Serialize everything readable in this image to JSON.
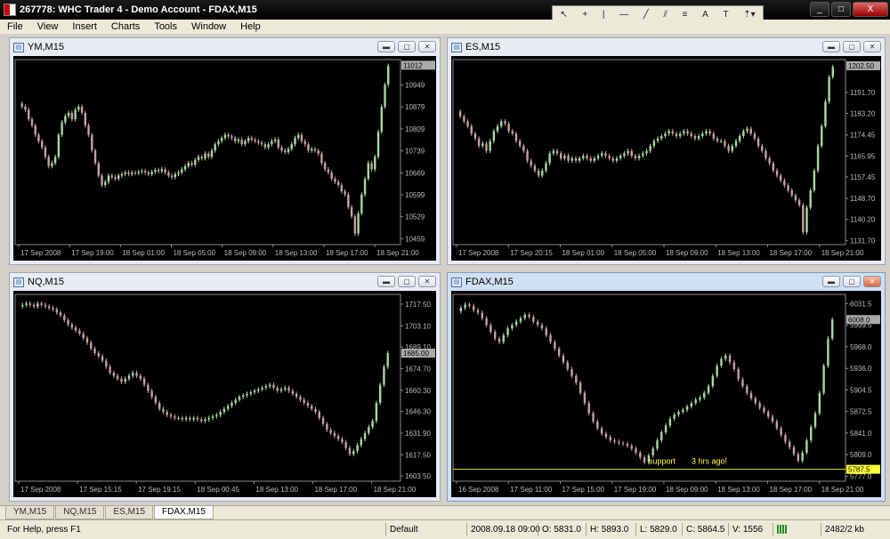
{
  "window": {
    "title": "267778: WHC Trader 4 - Demo Account - FDAX,M15",
    "minimize": "_",
    "maximize": "□",
    "close": "X"
  },
  "toolbox": {
    "icons": [
      "cursor-icon",
      "crosshair-icon",
      "vertical-line-icon",
      "horizontal-line-icon",
      "trendline-icon",
      "channel-icon",
      "fibonacci-icon",
      "text-icon",
      "label-icon",
      "arrow-icon"
    ]
  },
  "menu": [
    {
      "label": "File"
    },
    {
      "label": "View"
    },
    {
      "label": "Insert"
    },
    {
      "label": "Charts"
    },
    {
      "label": "Tools"
    },
    {
      "label": "Window"
    },
    {
      "label": "Help"
    }
  ],
  "charts": [
    {
      "id": "ym",
      "title": "YM,M15",
      "active": false,
      "price_labels": [
        "10949",
        "10879",
        "10809",
        "10739",
        "10669",
        "10599",
        "10529",
        "10459"
      ],
      "current_price": "11012",
      "time_labels": [
        "17 Sep 2008",
        "17 Sep 19:00",
        "18 Sep 01:00",
        "18 Sep 05:00",
        "18 Sep 09:00",
        "18 Sep 13:00",
        "18 Sep 17:00",
        "18 Sep 21:00"
      ],
      "ylim": [
        10440,
        11030
      ],
      "series": [
        10890,
        10880,
        10870,
        10840,
        10820,
        10790,
        10770,
        10750,
        10720,
        10690,
        10700,
        10720,
        10790,
        10830,
        10850,
        10860,
        10840,
        10870,
        10880,
        10860,
        10820,
        10790,
        10740,
        10700,
        10660,
        10630,
        10640,
        10660,
        10655,
        10650,
        10660,
        10665,
        10670,
        10665,
        10670,
        10668,
        10672,
        10675,
        10670,
        10665,
        10672,
        10678,
        10674,
        10680,
        10670,
        10660,
        10655,
        10665,
        10670,
        10680,
        10690,
        10700,
        10695,
        10710,
        10720,
        10715,
        10730,
        10720,
        10740,
        10760,
        10770,
        10780,
        10790,
        10785,
        10780,
        10770,
        10775,
        10760,
        10770,
        10780,
        10775,
        10770,
        10765,
        10760,
        10750,
        10760,
        10770,
        10775,
        10750,
        10740,
        10735,
        10745,
        10760,
        10780,
        10790,
        10770,
        10760,
        10740,
        10745,
        10740,
        10730,
        10700,
        10680,
        10670,
        10650,
        10640,
        10630,
        10610,
        10600,
        10560,
        10530,
        10475,
        10540,
        10600,
        10650,
        10700,
        10680,
        10720,
        10800,
        10880,
        10950,
        11010
      ]
    },
    {
      "id": "es",
      "title": "ES,M15",
      "active": false,
      "price_labels": [
        "1191.70",
        "1183.20",
        "1174.45",
        "1165.95",
        "1157.45",
        "1148.70",
        "1140.20",
        "1131.70"
      ],
      "current_price": "1202.50",
      "time_labels": [
        "17 Sep 2008",
        "17 Sep 20:15",
        "18 Sep 01:00",
        "18 Sep 05:00",
        "18 Sep 09:00",
        "18 Sep 13:00",
        "18 Sep 17:00",
        "18 Sep 21:00"
      ],
      "ylim": [
        1130,
        1205
      ],
      "series": [
        1184,
        1182,
        1180,
        1178,
        1175,
        1173,
        1170,
        1171,
        1168,
        1172,
        1176,
        1178,
        1180,
        1179,
        1176,
        1175,
        1172,
        1170,
        1168,
        1164,
        1162,
        1160,
        1158,
        1160,
        1163,
        1167,
        1168,
        1167,
        1165,
        1166,
        1164,
        1165,
        1164,
        1165,
        1166,
        1165,
        1164,
        1165,
        1166,
        1167,
        1166,
        1165,
        1164,
        1165,
        1166,
        1167,
        1168,
        1166,
        1165,
        1166,
        1167,
        1168,
        1170,
        1172,
        1173,
        1174,
        1175,
        1176,
        1175,
        1174,
        1175,
        1176,
        1175,
        1174,
        1173,
        1174,
        1175,
        1176,
        1175,
        1173,
        1172,
        1172,
        1170,
        1168,
        1170,
        1172,
        1174,
        1176,
        1177,
        1175,
        1173,
        1170,
        1168,
        1165,
        1163,
        1160,
        1158,
        1156,
        1154,
        1152,
        1150,
        1148,
        1146,
        1135,
        1145,
        1152,
        1160,
        1170,
        1178,
        1188,
        1198,
        1202
      ]
    },
    {
      "id": "nq",
      "title": "NQ,M15",
      "active": false,
      "price_labels": [
        "1717.50",
        "1703.10",
        "1689.10",
        "1674.70",
        "1660.30",
        "1646.30",
        "1631.90",
        "1617.50",
        "1603.50"
      ],
      "current_price": "1685.00",
      "time_labels": [
        "17 Sep 2008",
        "17 Sep 15:15",
        "17 Sep 19:15",
        "18 Sep 00:45",
        "18 Sep 13:00",
        "18 Sep 17:00",
        "18 Sep 21:00"
      ],
      "ylim": [
        1600,
        1724
      ],
      "series": [
        1716,
        1717,
        1718,
        1717,
        1716,
        1718,
        1717,
        1716,
        1715,
        1714,
        1712,
        1710,
        1707,
        1704,
        1702,
        1700,
        1698,
        1695,
        1692,
        1688,
        1685,
        1683,
        1680,
        1676,
        1672,
        1670,
        1668,
        1666,
        1668,
        1670,
        1672,
        1670,
        1668,
        1664,
        1660,
        1656,
        1652,
        1648,
        1646,
        1644,
        1643,
        1642,
        1642,
        1641,
        1642,
        1641,
        1642,
        1641,
        1640,
        1641,
        1642,
        1643,
        1644,
        1646,
        1648,
        1650,
        1652,
        1654,
        1656,
        1657,
        1658,
        1659,
        1660,
        1661,
        1662,
        1663,
        1664,
        1662,
        1660,
        1661,
        1662,
        1660,
        1658,
        1656,
        1654,
        1652,
        1650,
        1648,
        1646,
        1642,
        1638,
        1634,
        1632,
        1630,
        1628,
        1626,
        1622,
        1618,
        1620,
        1624,
        1628,
        1632,
        1636,
        1640,
        1652,
        1664,
        1676,
        1685
      ]
    },
    {
      "id": "fdax",
      "title": "FDAX,M15",
      "active": true,
      "price_labels": [
        "6031.5",
        "5999.5",
        "5968.0",
        "5936.0",
        "5904.5",
        "5872.5",
        "5841.0",
        "5809.0",
        "5777.0"
      ],
      "current_price": "6008.0",
      "support_price": "5787.5",
      "support_text": "support",
      "annotation_text": "3 hrs ago!",
      "time_labels": [
        "16 Sep 2008",
        "17 Sep 11:00",
        "17 Sep 15:00",
        "17 Sep 19:00",
        "18 Sep 09:00",
        "18 Sep 13:00",
        "18 Sep 17:00",
        "18 Sep 21:00"
      ],
      "ylim": [
        5770,
        6045
      ],
      "series": [
        6020,
        6025,
        6030,
        6028,
        6022,
        6018,
        6010,
        6000,
        5990,
        5980,
        5975,
        5985,
        5995,
        6000,
        6005,
        6010,
        6015,
        6012,
        6005,
        6000,
        5995,
        5985,
        5975,
        5965,
        5955,
        5945,
        5935,
        5925,
        5915,
        5900,
        5885,
        5870,
        5858,
        5848,
        5840,
        5835,
        5830,
        5828,
        5826,
        5825,
        5822,
        5818,
        5812,
        5805,
        5798,
        5808,
        5818,
        5830,
        5842,
        5852,
        5862,
        5868,
        5872,
        5875,
        5880,
        5885,
        5890,
        5893,
        5900,
        5910,
        5925,
        5940,
        5950,
        5955,
        5945,
        5935,
        5920,
        5910,
        5900,
        5892,
        5885,
        5878,
        5872,
        5865,
        5858,
        5848,
        5838,
        5828,
        5820,
        5810,
        5800,
        5812,
        5830,
        5850,
        5870,
        5900,
        5940,
        5980,
        6008
      ]
    }
  ],
  "tabs": [
    {
      "label": "YM,M15",
      "active": false
    },
    {
      "label": "NQ,M15",
      "active": false
    },
    {
      "label": "ES,M15",
      "active": false
    },
    {
      "label": "FDAX,M15",
      "active": true
    }
  ],
  "status": {
    "help": "For Help, press F1",
    "profile": "Default",
    "datetime": "2008.09.18 09:00",
    "open": "O: 5831.0",
    "high": "H: 5893.0",
    "low": "L: 5829.0",
    "close": "C: 5864.5",
    "volume": "V: 1556",
    "traffic": "2482/2 kb"
  },
  "colors": {
    "bull": "#a8d8a0",
    "bear": "#c8a0a0",
    "axis": "#8a8a8a",
    "support_line": "#e5e51a",
    "support_label_bg": "#ffff33"
  }
}
